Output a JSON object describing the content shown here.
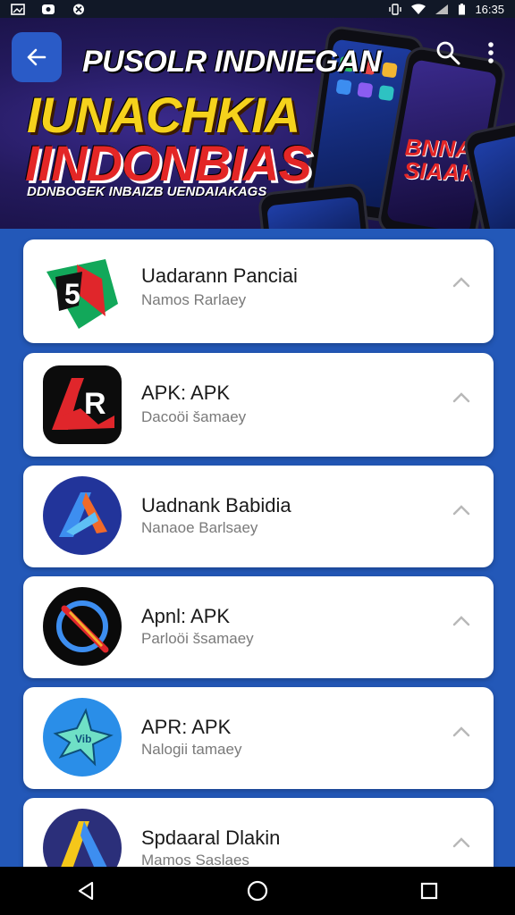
{
  "status_bar": {
    "time": "16:35",
    "left_icons": [
      "gallery-icon",
      "message-icon",
      "close-notification-icon"
    ],
    "right_icons": [
      "vibrate-icon",
      "wifi-icon",
      "signal-icon",
      "battery-icon"
    ]
  },
  "banner": {
    "line1": "PUSOLR INDNIEGAN",
    "line2": "IUNACHKIA",
    "line3": "IINDONBIAS",
    "line4": "DDNBOGEK INBAIZB UENDAIAKAGS",
    "phone_text": "BNNAR SIAAK",
    "colors": {
      "yellow": "#f5d21c",
      "red": "#e32626",
      "bg": "#241a5e"
    }
  },
  "app_bar": {
    "back_icon": "arrow-left-icon",
    "search_icon": "search-icon",
    "more_icon": "more-vert-icon"
  },
  "apps": [
    {
      "title": "Uadarann Panciai",
      "subtitle": "Namos Rarlaey",
      "icon": "app-logo-red-green"
    },
    {
      "title": "APK: APK",
      "subtitle": "Dacoöi šamaey",
      "icon": "app-logo-ar-black"
    },
    {
      "title": "Uadnank Babidia",
      "subtitle": "Nanaoe Barlsaey",
      "icon": "app-logo-blue-a"
    },
    {
      "title": "Apnl: APK",
      "subtitle": "Parloöi šsamaey",
      "icon": "app-logo-circle-slash"
    },
    {
      "title": "APR: APK",
      "subtitle": "Nalogii tamaey",
      "icon": "app-logo-blue-star"
    },
    {
      "title": "Spdaaral Dlakin",
      "subtitle": "Mamos Saslaes",
      "icon": "app-logo-yellow-a"
    }
  ],
  "nav": {
    "back_icon": "nav-back-icon",
    "home_icon": "nav-home-icon",
    "recents_icon": "nav-recents-icon"
  },
  "colors": {
    "page_bg": "#2358b8",
    "card_bg": "#ffffff",
    "title": "#1a1a1a",
    "subtitle": "#7a7a7a"
  }
}
